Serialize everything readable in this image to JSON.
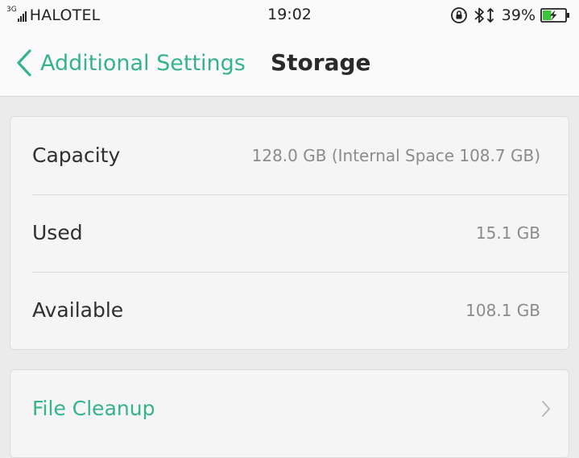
{
  "status_bar": {
    "network_type": "3G",
    "carrier": "HALOTEL",
    "time": "19:02",
    "battery_percent": "39%",
    "battery_level": 0.39,
    "icons": [
      "signal-icon",
      "rotation-lock-icon",
      "bluetooth-icon",
      "battery-charging-icon"
    ]
  },
  "header": {
    "back_label": "Additional Settings",
    "title": "Storage"
  },
  "storage": {
    "rows": [
      {
        "label": "Capacity",
        "value": "128.0 GB (Internal Space 108.7 GB)"
      },
      {
        "label": "Used",
        "value": "15.1 GB"
      },
      {
        "label": "Available",
        "value": "108.1 GB"
      }
    ]
  },
  "actions": {
    "file_cleanup": "File Cleanup"
  },
  "colors": {
    "accent": "#35b48c",
    "battery_fill": "#3cc43c",
    "background": "#ebebeb",
    "card": "#f5f5f5"
  }
}
